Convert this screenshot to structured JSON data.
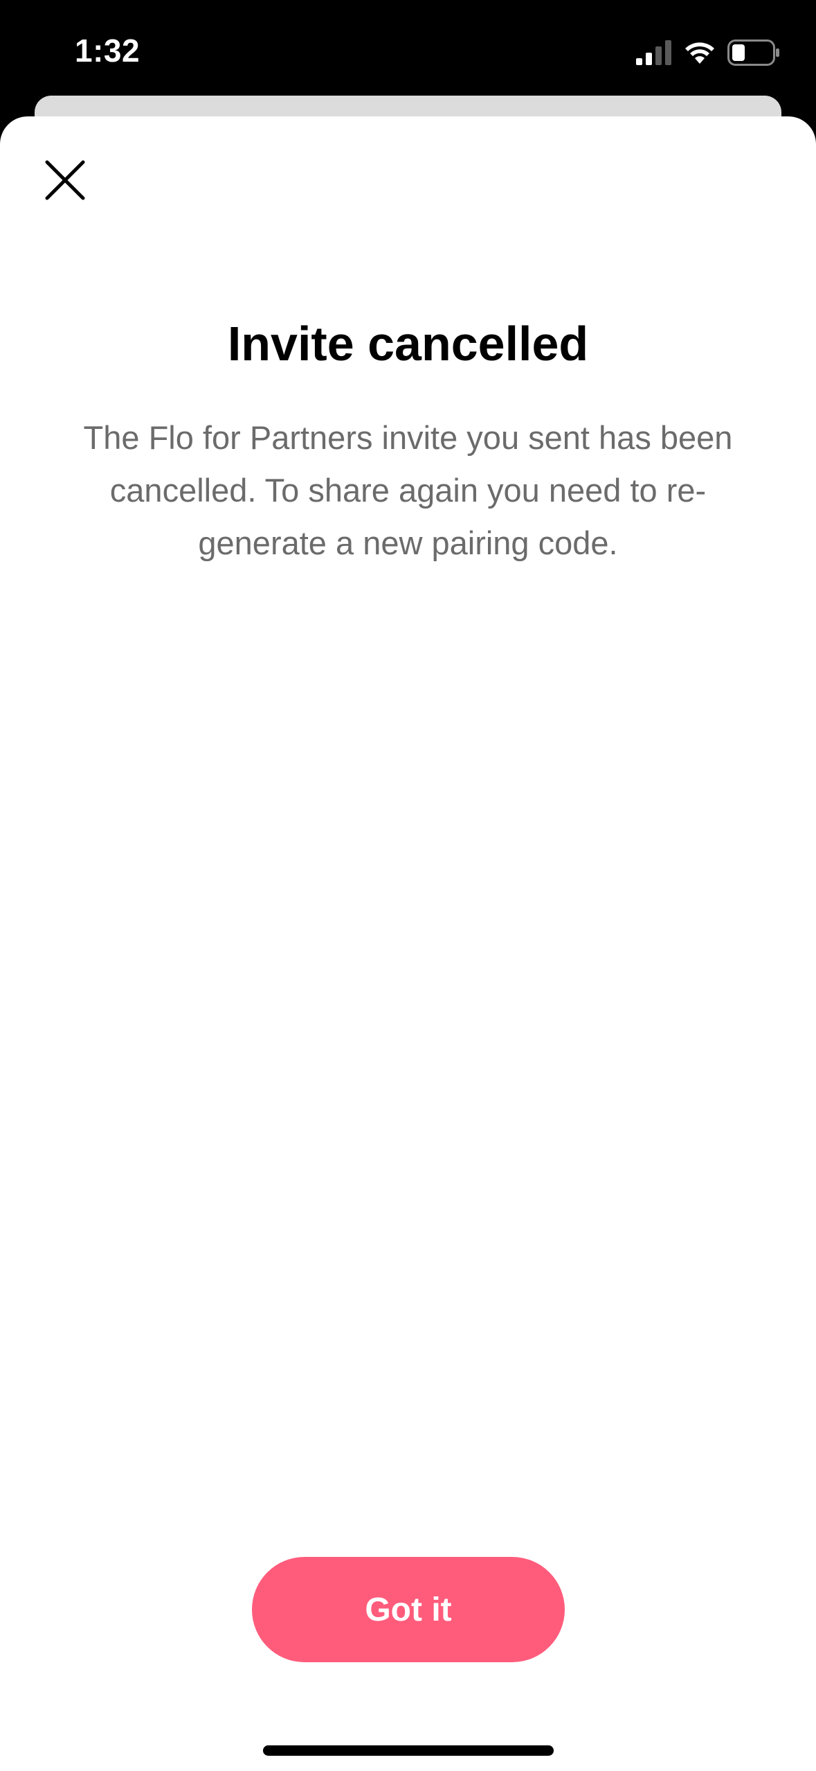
{
  "status_bar": {
    "time": "1:32",
    "icons": [
      "cellular-signal-icon",
      "wifi-icon",
      "battery-icon"
    ]
  },
  "modal": {
    "close_icon": "close-icon",
    "title": "Invite cancelled",
    "message": "The Flo for Partners invite you sent has been cancelled. To share again you need to re-generate a new pairing code.",
    "primary_button_label": "Got it"
  },
  "colors": {
    "accent": "#ff5c7c",
    "title_text": "#000000",
    "body_text": "#6b6b6b",
    "background": "#ffffff"
  }
}
